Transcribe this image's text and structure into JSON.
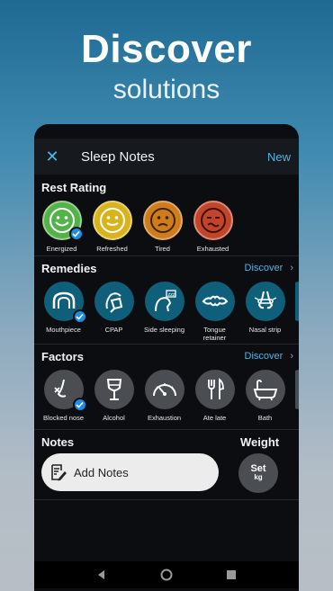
{
  "hero": {
    "title": "Discover",
    "subtitle": "solutions"
  },
  "appbar": {
    "close_icon": "close-icon",
    "title": "Sleep Notes",
    "new_label": "New"
  },
  "rest_rating": {
    "heading": "Rest Rating",
    "items": [
      {
        "label": "Energized",
        "color": "#53b34a",
        "selected": true
      },
      {
        "label": "Refreshed",
        "color": "#d9b31c",
        "selected": false
      },
      {
        "label": "Tired",
        "color": "#cf7d1b",
        "selected": false
      },
      {
        "label": "Exhausted",
        "color": "#c2452a",
        "selected": false
      }
    ]
  },
  "remedies": {
    "heading": "Remedies",
    "discover_label": "Discover",
    "items": [
      {
        "label": "Mouthpiece",
        "icon": "mouthpiece-icon",
        "selected": true
      },
      {
        "label": "CPAP",
        "icon": "cpap-mask-icon",
        "selected": false
      },
      {
        "label": "Side sleeping",
        "icon": "side-sleeping-icon",
        "selected": false
      },
      {
        "label": "Tongue retainer",
        "icon": "tongue-retainer-icon",
        "selected": false
      },
      {
        "label": "Nasal strip",
        "icon": "nasal-strip-icon",
        "selected": false
      }
    ]
  },
  "factors": {
    "heading": "Factors",
    "discover_label": "Discover",
    "items": [
      {
        "label": "Blocked nose",
        "icon": "blocked-nose-icon",
        "selected": true
      },
      {
        "label": "Alcohol",
        "icon": "wine-glass-icon",
        "selected": false
      },
      {
        "label": "Exhaustion",
        "icon": "gauge-icon",
        "selected": false
      },
      {
        "label": "Ate late",
        "icon": "fork-knife-icon",
        "selected": false
      },
      {
        "label": "Bath",
        "icon": "bathtub-icon",
        "selected": false
      }
    ]
  },
  "notes": {
    "heading": "Notes",
    "button_label": "Add Notes"
  },
  "weight": {
    "heading": "Weight",
    "set_label": "Set",
    "unit": "kg"
  },
  "colors": {
    "accent": "#4fb6e6",
    "check": "#1f8ee0",
    "remedy_bg": "#0f5e7a",
    "factor_bg": "#4a4d52"
  }
}
